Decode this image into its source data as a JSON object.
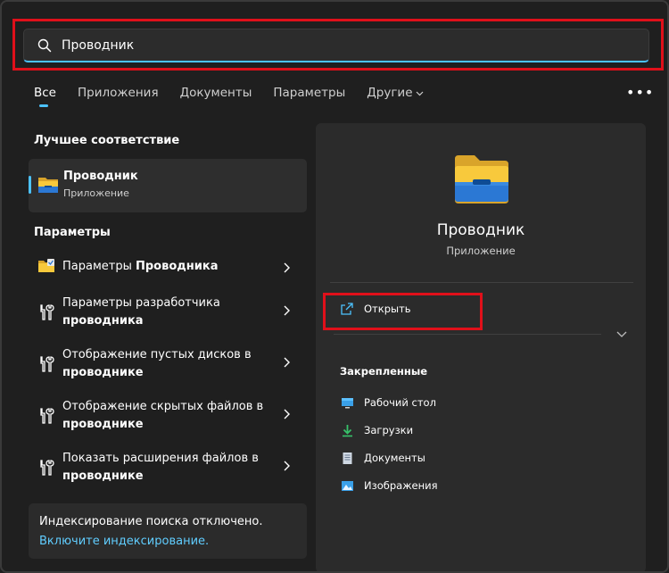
{
  "search": {
    "value": "Проводник",
    "icon": "search-icon"
  },
  "tabs": [
    {
      "label": "Все",
      "active": true
    },
    {
      "label": "Приложения"
    },
    {
      "label": "Документы"
    },
    {
      "label": "Параметры"
    },
    {
      "label": "Другие"
    }
  ],
  "more_label": "•••",
  "best_match": {
    "section_title": "Лучшее соответствие",
    "title": "Проводник",
    "subtitle": "Приложение",
    "icon": "folder-icon"
  },
  "settings": {
    "section_title": "Параметры",
    "items": [
      {
        "text": "Параметры ",
        "bold": "Проводника",
        "icon": "folder-settings-icon"
      },
      {
        "text": "Параметры разработчика ",
        "bold": "проводника",
        "icon": "tools-icon"
      },
      {
        "text": "Отображение пустых дисков в ",
        "bold": "проводнике",
        "icon": "tools-icon"
      },
      {
        "text": "Отображение скрытых файлов в ",
        "bold": "проводнике",
        "icon": "tools-icon"
      },
      {
        "text": "Показать расширения файлов в ",
        "bold": "проводнике",
        "icon": "tools-icon"
      }
    ]
  },
  "indexing": {
    "text": "Индексирование поиска отключено.",
    "link": "Включите индексирование."
  },
  "detail": {
    "title": "Проводник",
    "subtitle": "Приложение",
    "open_label": "Открыть",
    "pinned_title": "Закрепленные",
    "pinned": [
      {
        "label": "Рабочий стол",
        "icon": "desktop-icon"
      },
      {
        "label": "Загрузки",
        "icon": "download-icon"
      },
      {
        "label": "Документы",
        "icon": "document-icon"
      },
      {
        "label": "Изображения",
        "icon": "pictures-icon"
      }
    ]
  },
  "colors": {
    "accent": "#4cc2ff",
    "highlight": "#e0101a",
    "link": "#60cdff",
    "folder_yellow": "#f8c93c"
  }
}
